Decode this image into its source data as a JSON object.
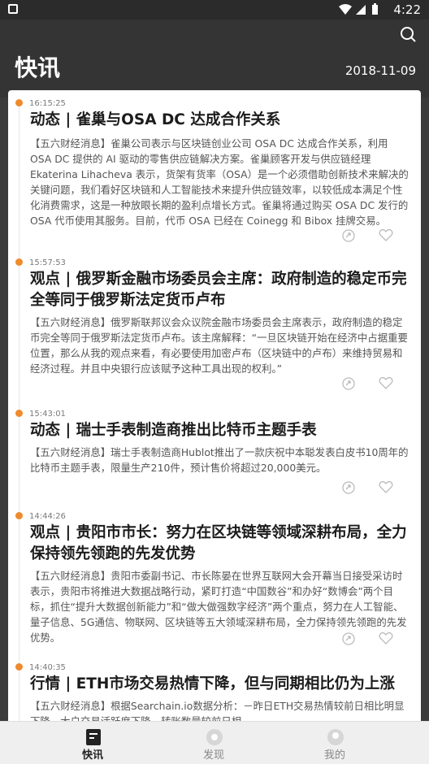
{
  "status": {
    "time": "4:22"
  },
  "header": {
    "title": "快讯",
    "date": "2018-11-09"
  },
  "entries": [
    {
      "time": "16:15:25",
      "title": "动态 | 雀巢与OSA DC 达成合作关系",
      "body": "【五六财经消息】雀巢公司表示与区块链创业公司 OSA DC 达成合作关系，利用 OSA DC 提供的 AI 驱动的零售供应链解决方案。雀巢顾客开发与供应链经理 Ekaterina Lihacheva 表示，货架有货率（OSA）是一个必须借助创新技术来解决的关键问题，我们看好区块链和人工智能技术来提升供应链效率，以较低成本满足个性化消费需求，这是一种放眼长期的盈利点增长方式。雀巢将通过购买 OSA DC 发行的 OSA 代币使用其服务。目前，代币 OSA 已经在 Coinegg 和 Bibox 挂牌交易。"
    },
    {
      "time": "15:57:53",
      "title": "观点 | 俄罗斯金融市场委员会主席：政府制造的稳定币完全等同于俄罗斯法定货币卢布",
      "body": "【五六财经消息】俄罗斯联邦议会众议院金融市场委员会主席表示，政府制造的稳定币完全等同于俄罗斯法定货币卢布。该主席解释：“一旦区块链开始在经济中占据重要位置，那么从我的观点来看，有必要使用加密卢布（区块链中的卢布）来维持贸易和经济过程。并且中央银行应该赋予这种工具出现的权利。”"
    },
    {
      "time": "15:43:01",
      "title": "动态 | 瑞士手表制造商推出比特币主题手表",
      "body": "【五六财经消息】瑞士手表制造商Hublot推出了一款庆祝中本聪发表白皮书10周年的比特币主题手表，限量生产210件，预计售价将超过20,000美元。"
    },
    {
      "time": "14:44:26",
      "title": "观点 | 贵阳市市长：努力在区块链等领域深耕布局，全力保持领先领跑的先发优势",
      "body": "【五六财经消息】贵阳市委副书记、市长陈晏在世界互联网大会开幕当日接受采访时表示，贵阳市将推进大数据战略行动，紧盯打造“中国数谷”和办好“数博会”两个目标，抓住“提升大数据创新能力”和“做大做强数字经济”两个重点，努力在人工智能、量子信息、5G通信、物联网、区块链等五大领域深耕布局，全力保持领先领跑的先发优势。"
    },
    {
      "time": "14:40:35",
      "title": "行情 | ETH市场交易热情下降，但与同期相比仍为上涨",
      "body": "【五六财经消息】根据Searchain.io数据分析：－昨日ETH交易热情较前日相比明显下降，大户交易活跃度下降，转账数量较前日相"
    }
  ],
  "nav": [
    {
      "label": "快讯",
      "active": true
    },
    {
      "label": "发现",
      "active": false
    },
    {
      "label": "我的",
      "active": false
    }
  ],
  "colors": {
    "accent": "#ef8a2d",
    "header_bg": "#343434"
  }
}
